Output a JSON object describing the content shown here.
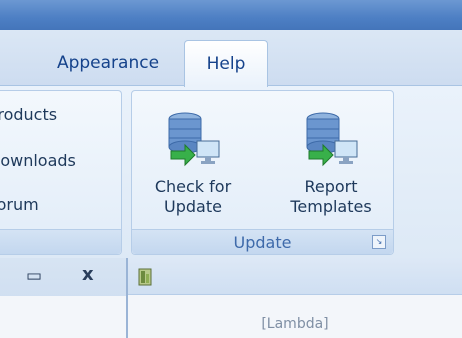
{
  "tabs": [
    {
      "label": "Appearance"
    },
    {
      "label": "Help"
    }
  ],
  "left_group": {
    "items": [
      "Products",
      "Downloads",
      "Forum"
    ]
  },
  "update_group": {
    "label": "Update",
    "buttons": [
      {
        "line1": "Check for",
        "line2": "Update"
      },
      {
        "line1": "Report",
        "line2": "Templates"
      }
    ]
  },
  "lower_left_pane": {
    "pin_icon": "window-restore-icon",
    "close_label": "x"
  },
  "lower_right_pane": {
    "placeholder": "[Lambda]"
  },
  "colors": {
    "title_blue": "#4d7fc4",
    "text_blue": "#15428b",
    "group_label": "#3e6aaa"
  }
}
